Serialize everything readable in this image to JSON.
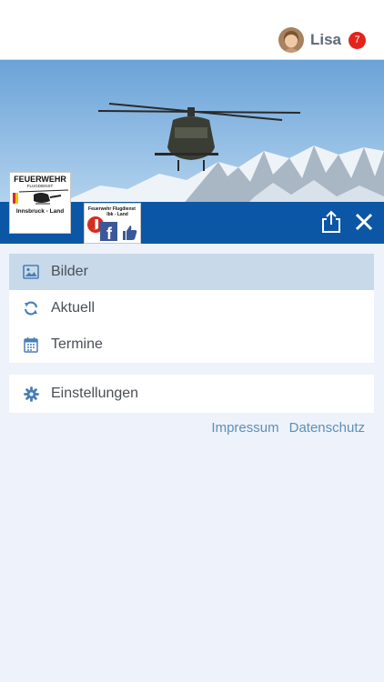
{
  "header": {
    "username": "Lisa",
    "notification_count": "7"
  },
  "logos": {
    "logo1": {
      "line1": "FEUERWEHR",
      "line2": "FLUGDIENST",
      "line3": "Innsbruck - Land"
    },
    "logo2": {
      "line1": "Feuerwehr Flugdienst",
      "line2": "Ibk - Land"
    }
  },
  "menu": {
    "items": [
      {
        "label": "Bilder",
        "icon": "image-icon",
        "active": true
      },
      {
        "label": "Aktuell",
        "icon": "refresh-icon",
        "active": false
      },
      {
        "label": "Termine",
        "icon": "calendar-icon",
        "active": false
      }
    ],
    "settings": {
      "label": "Einstellungen",
      "icon": "gear-icon"
    }
  },
  "footer_links": {
    "impressum": "Impressum",
    "datenschutz": "Datenschutz"
  },
  "colors": {
    "accent": "#0c56a6",
    "active_row": "#c8d9ea",
    "icon": "#4a7fb5",
    "badge": "#e2241b",
    "link": "#5d8fb8",
    "background": "#eef2fa"
  }
}
